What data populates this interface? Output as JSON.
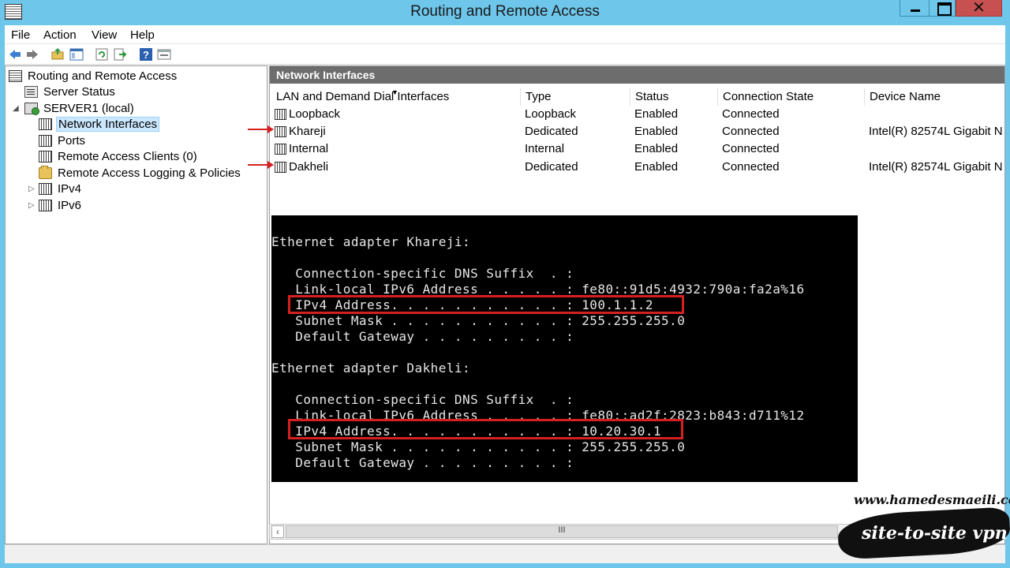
{
  "window": {
    "title": "Routing and Remote Access",
    "close_glyph": "✕"
  },
  "menu": [
    "File",
    "Action",
    "View",
    "Help"
  ],
  "toolbar": [
    "back-icon",
    "forward-icon",
    "up-folder-icon",
    "show-hide-tree-icon",
    "refresh-icon",
    "export-icon",
    "help-icon",
    "properties-icon"
  ],
  "tree": {
    "root": "Routing and Remote Access",
    "server_status": "Server Status",
    "server": "SERVER1 (local)",
    "network_interfaces": "Network Interfaces",
    "ports": "Ports",
    "remote_clients": "Remote Access Clients (0)",
    "logging": "Remote Access Logging & Policies",
    "ipv4": "IPv4",
    "ipv6": "IPv6"
  },
  "panel": {
    "header": "Network Interfaces",
    "columns": [
      "LAN and Demand Dial Interfaces",
      "Type",
      "Status",
      "Connection State",
      "Device Name"
    ],
    "rows": [
      {
        "name": "Loopback",
        "type": "Loopback",
        "status": "Enabled",
        "state": "Connected",
        "device": ""
      },
      {
        "name": "Khareji",
        "type": "Dedicated",
        "status": "Enabled",
        "state": "Connected",
        "device": "Intel(R) 82574L Gigabit N"
      },
      {
        "name": "Internal",
        "type": "Internal",
        "status": "Enabled",
        "state": "Connected",
        "device": ""
      },
      {
        "name": "Dakheli",
        "type": "Dedicated",
        "status": "Enabled",
        "state": "Connected",
        "device": "Intel(R) 82574L Gigabit N"
      }
    ]
  },
  "console": {
    "lines": [
      "Ethernet adapter Khareji:",
      "   Connection-specific DNS Suffix  . :",
      "   Link-local IPv6 Address . . . . . : fe80::91d5:4932:790a:fa2a%16",
      "   IPv4 Address. . . . . . . . . . . : 100.1.1.2",
      "   Subnet Mask . . . . . . . . . . . : 255.255.255.0",
      "   Default Gateway . . . . . . . . . :",
      "Ethernet adapter Dakheli:",
      "   Connection-specific DNS Suffix  . :",
      "   Link-local IPv6 Address . . . . . : fe80::ad2f:2823:b843:d711%12",
      "   IPv4 Address. . . . . . . . . . . : 10.20.30.1",
      "   Subnet Mask . . . . . . . . . . . : 255.255.255.0",
      "   Default Gateway . . . . . . . . . :"
    ]
  },
  "scrollbar": {
    "grip": "III"
  },
  "watermark": {
    "url": "www.hamedesmaeili.com",
    "tag": "site-to-site vpn"
  },
  "colors": {
    "titlebar": "#6ec6ea",
    "highlight": "#d62020",
    "section_header": "#6d6d6d",
    "close": "#c75050"
  }
}
